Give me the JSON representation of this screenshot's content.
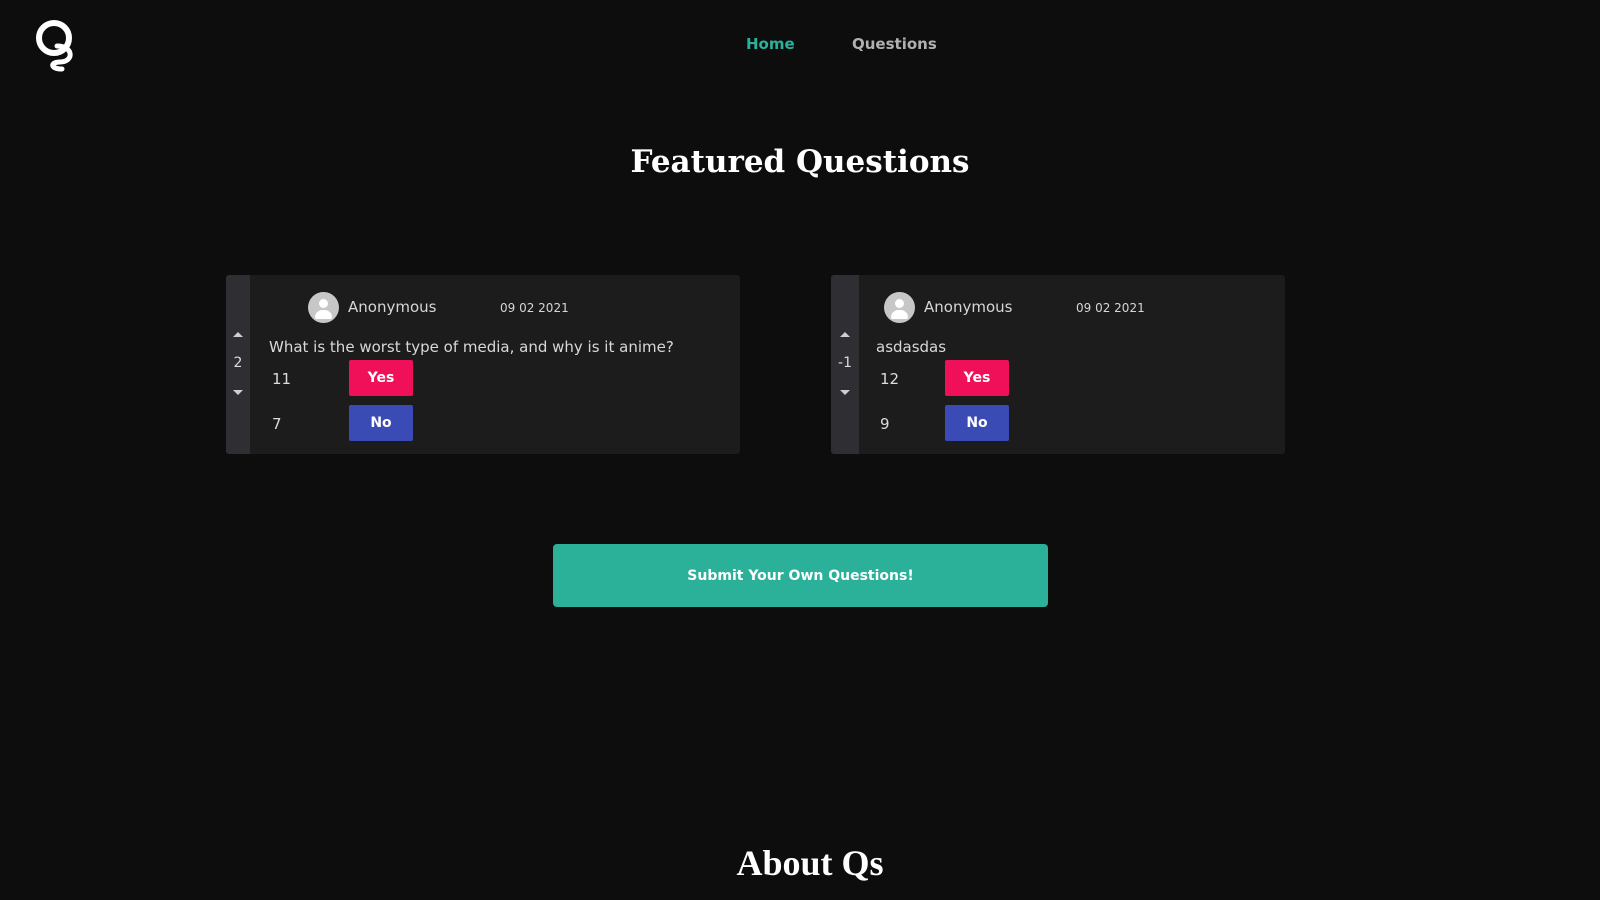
{
  "colors": {
    "background": "#0d0d0d",
    "accent_teal": "#2bb09a",
    "nav_inactive": "#b0b0b0",
    "yes_button": "#f0105a",
    "no_button": "#3a4bb5",
    "card_background": "#1c1c1d"
  },
  "header": {
    "logo_icon": "qs-logo-icon",
    "nav": {
      "home_label": "Home",
      "questions_label": "Questions"
    }
  },
  "featured": {
    "title": "Featured Questions",
    "cards": [
      {
        "score": "2",
        "avatar_icon": "user-avatar-icon",
        "author": "Anonymous",
        "date": "09 02 2021",
        "question": "What is the worst type of media, and why is it anime?",
        "yes_count": "11",
        "yes_label": "Yes",
        "no_count": "7",
        "no_label": "No"
      },
      {
        "score": "-1",
        "avatar_icon": "user-avatar-icon",
        "author": "Anonymous",
        "date": "09 02 2021",
        "question": "asdasdas",
        "yes_count": "12",
        "yes_label": "Yes",
        "no_count": "9",
        "no_label": "No"
      }
    ]
  },
  "submit_label": "Submit Your Own Questions!",
  "about": {
    "title": "About Qs"
  }
}
